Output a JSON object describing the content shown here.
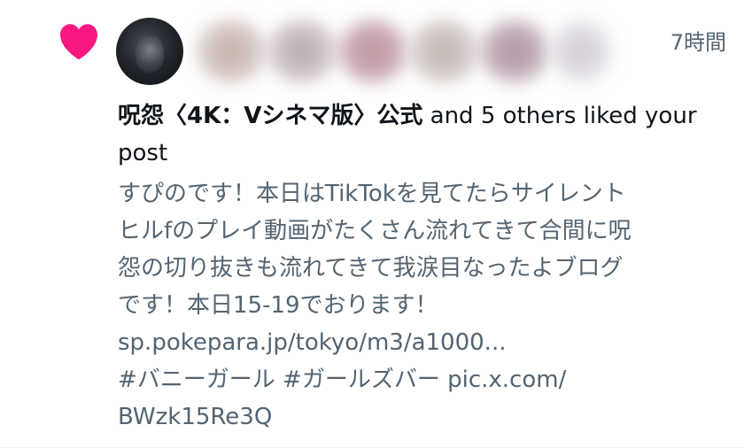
{
  "notification": {
    "type_icon": "heart-icon",
    "accent_color": "#f91880",
    "time": "7時間",
    "actor_name": "呪怨〈4K：Vシネマ版〉公式",
    "action_text": "and 5 others liked your post",
    "post_lines": [
      "すぴのです！本日はTikTokを見てたらサイレント",
      "ヒルfのプレイ動画がたくさん流れてきて合間に呪",
      "怨の切り抜きも流れてきて我涙目なったよブログ",
      "です！本日15-19でおります！",
      "sp.pokepara.jp/tokyo/m3/a1000...",
      "#バニーガール #ガールズバー pic.x.com/",
      "BWzk15Re3Q"
    ]
  }
}
